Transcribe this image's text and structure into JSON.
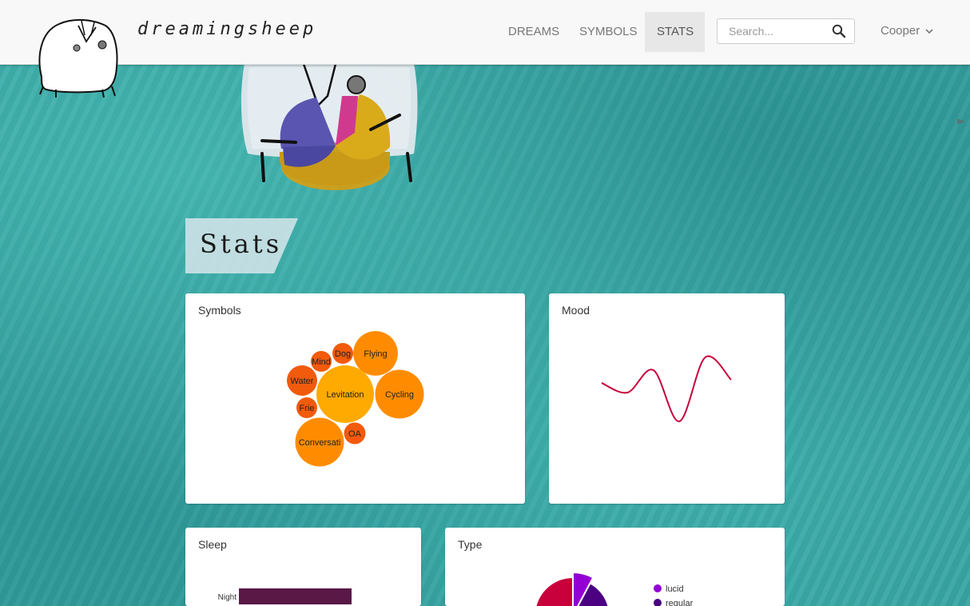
{
  "brand": {
    "name": "dreamingsheep"
  },
  "nav": {
    "items": [
      {
        "label": "DREAMS",
        "active": false
      },
      {
        "label": "SYMBOLS",
        "active": false
      },
      {
        "label": "STATS",
        "active": true
      }
    ],
    "search": {
      "placeholder": "Search...",
      "value": ""
    },
    "user": {
      "label": "Cooper"
    }
  },
  "page": {
    "title": "Stats"
  },
  "panels": {
    "symbols": {
      "title": "Symbols"
    },
    "mood": {
      "title": "Mood"
    },
    "sleep": {
      "title": "Sleep"
    },
    "type": {
      "title": "Type"
    }
  },
  "colors": {
    "accent": "#c8003c",
    "bubble_light": "#ffaa00",
    "bubble_mid": "#ff8c00",
    "bubble_dark": "#f25a0c",
    "sleep_bar": "#5a1846",
    "lucid": "#9400d3",
    "regular": "#4b0082"
  },
  "chart_data": [
    {
      "type": "bubble",
      "title": "Symbols",
      "items": [
        {
          "label": "Levitation",
          "value": 100
        },
        {
          "label": "Cycling",
          "value": 72
        },
        {
          "label": "Conversati",
          "value": 72
        },
        {
          "label": "Flying",
          "value": 60
        },
        {
          "label": "Water",
          "value": 28
        },
        {
          "label": "OA",
          "value": 14
        },
        {
          "label": "Frie",
          "value": 13
        },
        {
          "label": "Dog",
          "value": 13
        },
        {
          "label": "Mind",
          "value": 13
        }
      ]
    },
    {
      "type": "line",
      "title": "Mood",
      "values": [
        0.2,
        -0.1,
        0.6,
        -1.0,
        1.0,
        0.3
      ]
    },
    {
      "type": "bar",
      "title": "Sleep",
      "categories": [
        "Night"
      ],
      "values": [
        141
      ]
    },
    {
      "type": "pie",
      "title": "Type",
      "legend": [
        "lucid",
        "regular"
      ]
    }
  ]
}
